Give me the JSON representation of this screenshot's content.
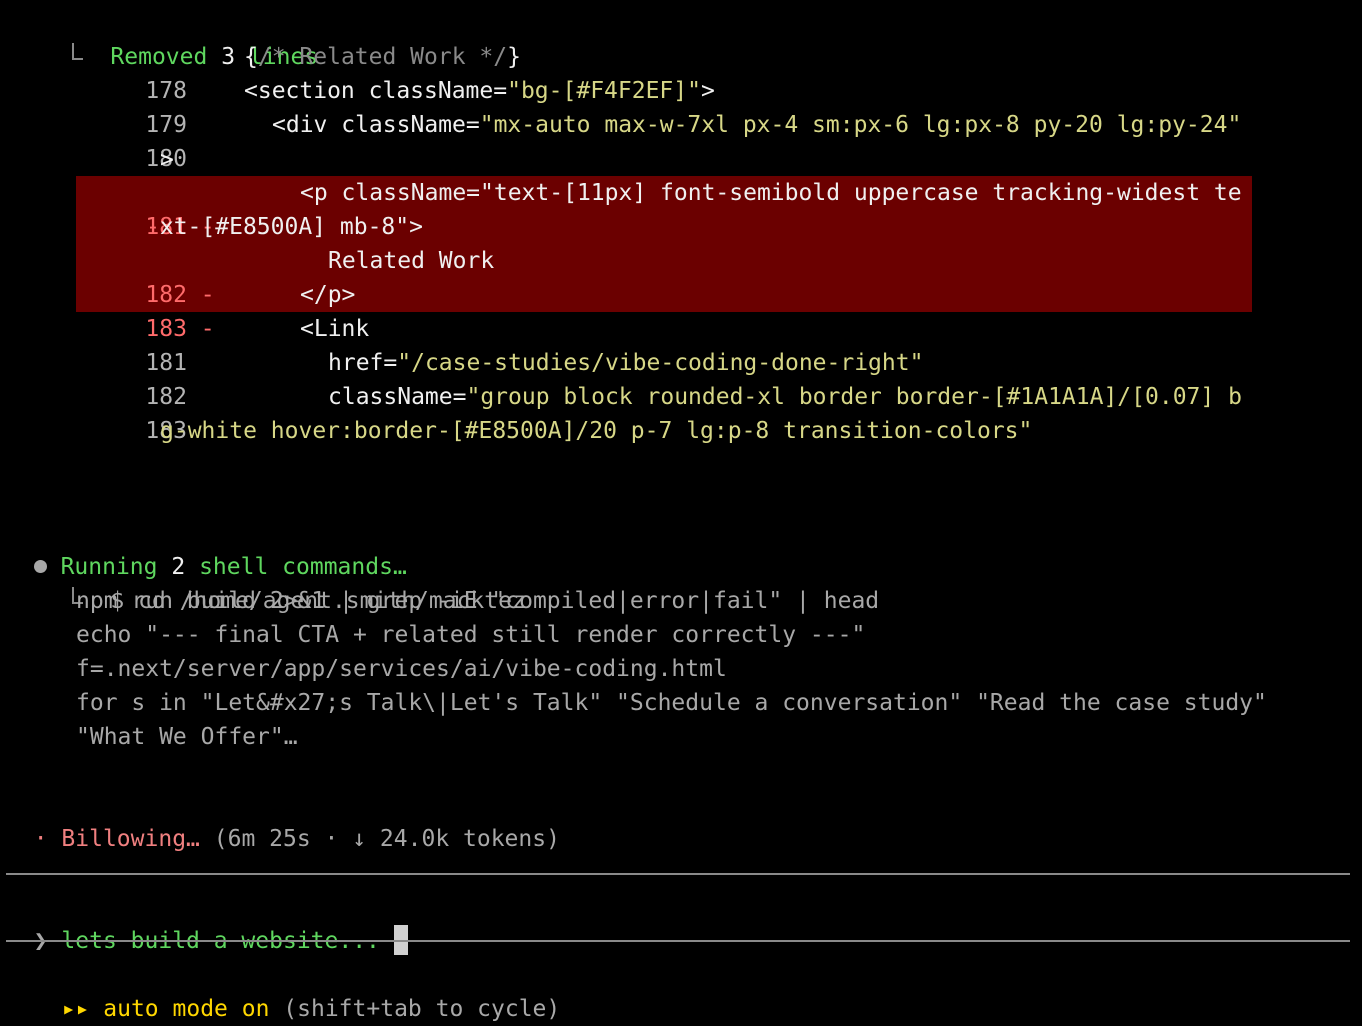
{
  "diff": {
    "summary": {
      "verb": "Removed",
      "count": "3",
      "unit": "lines"
    },
    "context_before": [
      {
        "num": "178",
        "segments": [
          {
            "text": "{",
            "color": "white"
          },
          {
            "text": "/* Related Work */",
            "color": "comment"
          },
          {
            "text": "}",
            "color": "white"
          }
        ]
      },
      {
        "num": "179",
        "segments": [
          {
            "text": "<section className=",
            "color": "white"
          },
          {
            "text": "\"bg-[#F4F2EF]\"",
            "color": "yellow"
          },
          {
            "text": ">",
            "color": "white"
          }
        ]
      },
      {
        "num": "180",
        "segments": [
          {
            "text": "<div className=",
            "color": "white"
          },
          {
            "text": "\"mx-auto max-w-7xl px-4 sm:px-6 lg:px-8 py-20 lg:py-24\"",
            "color": "yellow"
          }
        ],
        "wrap": ">"
      }
    ],
    "removed": [
      {
        "num": "181",
        "marker": "-",
        "text": "<p className=\"text-[11px] font-semibold uppercase tracking-widest te",
        "wrap_marker": "-",
        "wrap": "xt-[#E8500A] mb-8\">"
      },
      {
        "num": "182",
        "marker": "-",
        "text": "Related Work"
      },
      {
        "num": "183",
        "marker": "-",
        "text": "</p>"
      }
    ],
    "context_after": [
      {
        "num": "181",
        "segments": [
          {
            "text": "<Link",
            "color": "white"
          }
        ]
      },
      {
        "num": "182",
        "segments": [
          {
            "text": "href=",
            "color": "white"
          },
          {
            "text": "\"/case-studies/vibe-coding-done-right\"",
            "color": "yellow"
          }
        ]
      },
      {
        "num": "183",
        "segments": [
          {
            "text": "className=",
            "color": "white"
          },
          {
            "text": "\"group block rounded-xl border border-[#1A1A1A]/[0.07] b",
            "color": "yellow"
          }
        ],
        "wrap": "g-white hover:border-[#E8500A]/20 p-7 lg:p-8 transition-colors\""
      }
    ]
  },
  "shell": {
    "verb": "Running",
    "count": "2",
    "rest": "shell commands…",
    "commands": [
      "$ cd /home/agent.smith/macktez",
      "npm run build 2>&1 | grep -iE \"compiled|error|fail\" | head",
      "echo \"--- final CTA + related still render correctly ---\"",
      "f=.next/server/app/services/ai/vibe-coding.html",
      "for s in \"Let&#x27;s Talk\\|Let's Talk\" \"Schedule a conversation\" \"Read the case study\"",
      "\"What We Offer\"…"
    ]
  },
  "status": {
    "dot": "·",
    "label": "Billowing…",
    "details": "(6m 25s · ↓ 24.0k tokens)"
  },
  "prompt": {
    "chevron": "❯",
    "input_value": "lets build a website..."
  },
  "footer": {
    "arrows": "▸▸",
    "mode": "auto mode on",
    "hint": "(shift+tab to cycle)"
  },
  "colors": {
    "background": "#000000",
    "removed_background": "#6b0000",
    "green": "#5fd75f",
    "string": "#d7d787",
    "removed_number": "#ff6b6b",
    "status": "#f08080",
    "mode": "#ffd700"
  }
}
